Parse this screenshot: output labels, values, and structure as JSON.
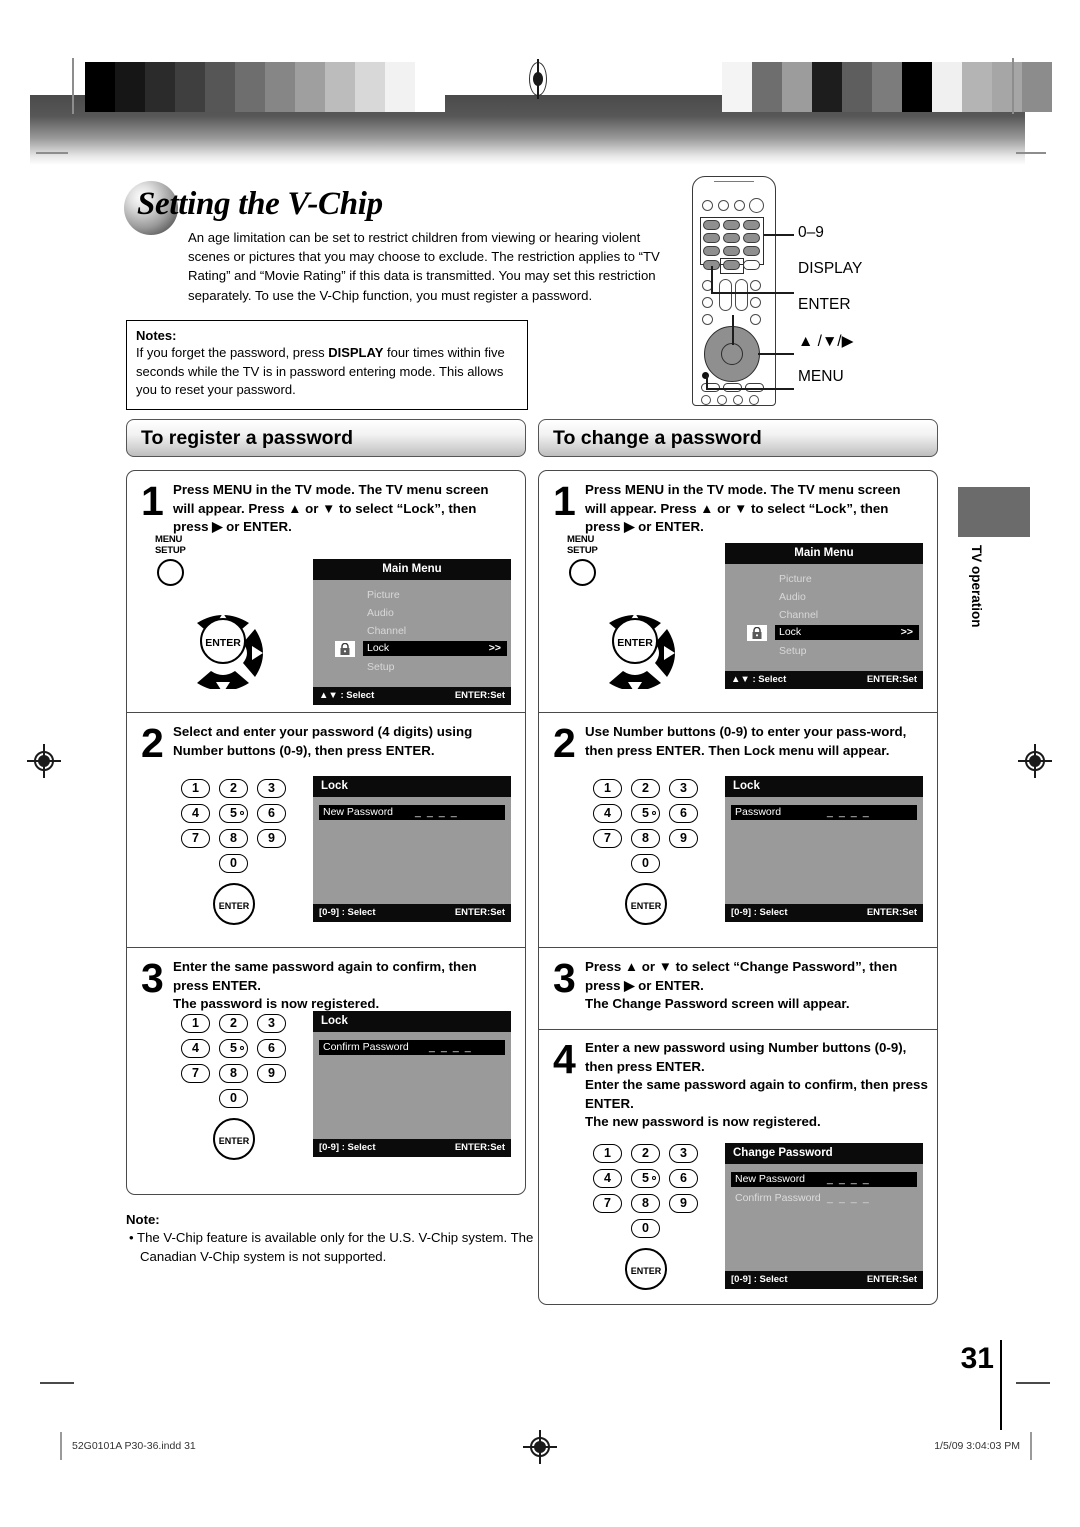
{
  "document": {
    "page_title": "Setting the V-Chip",
    "page_number": "31",
    "side_tab_label": "TV operation",
    "footer_left": "52G0101A P30-36.indd   31",
    "footer_right": "1/5/09   3:04:03 PM"
  },
  "intro": {
    "paragraph": "An age limitation can be set to restrict children from viewing or hearing violent scenes or pictures that you may choose to exclude.  The restriction applies to “TV Rating” and “Movie Rating” if this data is transmitted.  You may set this restriction separately.  To use the V-Chip function, you must register a password."
  },
  "notes_box": {
    "title": "Notes:",
    "text_part1": "If you forget the password, press ",
    "emphasis": "DISPLAY",
    "text_part2": " four times within five seconds while the TV is in password entering mode. This allows you to reset your password."
  },
  "remote": {
    "callouts": [
      {
        "label": "0–9"
      },
      {
        "label": "DISPLAY"
      },
      {
        "label": "ENTER"
      },
      {
        "label": "▲ /▼/▶"
      },
      {
        "label": "MENU"
      }
    ]
  },
  "keypad": {
    "keys": [
      "1",
      "2",
      "3",
      "4",
      "5",
      "6",
      "7",
      "8",
      "9",
      "0"
    ],
    "enter_label": "ENTER",
    "menu_setup_line1": "MENU",
    "menu_setup_line2": "SETUP"
  },
  "osd": {
    "main_menu": {
      "title": "Main Menu",
      "items": [
        "Picture",
        "Audio",
        "Channel",
        "Lock",
        "Setup"
      ],
      "selected_item": "Lock",
      "selected_value": ">>",
      "icon": "lock-icon",
      "foot_left": "▲▼ : Select",
      "foot_right": "ENTER:Set"
    },
    "lock_new": {
      "title": "Lock",
      "field_label": "New Password",
      "field_value": "_ _ _ _",
      "foot_left": "[0-9] : Select",
      "foot_right": "ENTER:Set"
    },
    "lock_confirm": {
      "title": "Lock",
      "field_label": "Confirm Password",
      "field_value": "_ _ _ _",
      "foot_left": "[0-9] : Select",
      "foot_right": "ENTER:Set"
    },
    "lock_password": {
      "title": "Lock",
      "field_label": "Password",
      "field_value": "_ _ _ _",
      "foot_left": "[0-9] : Select",
      "foot_right": "ENTER:Set"
    },
    "change_password": {
      "title": "Change Password",
      "field1_label": "New Password",
      "field1_value": "_ _ _ _",
      "field2_label": "Confirm Password",
      "field2_value": "_ _ _ _",
      "foot_left": "[0-9] : Select",
      "foot_right": "ENTER:Set"
    }
  },
  "register_section": {
    "header": "To register a password",
    "steps": [
      {
        "num": "1",
        "text": "Press MENU in the TV mode. The TV menu screen will appear. Press ▲ or ▼ to select “Lock”, then press ▶ or ENTER."
      },
      {
        "num": "2",
        "text": "Select and enter your password (4 digits) using Number buttons (0-9), then press ENTER."
      },
      {
        "num": "3",
        "text": "Enter the same password again to confirm, then press ENTER.\nThe password is now registered."
      }
    ]
  },
  "change_section": {
    "header": "To change a password",
    "steps": [
      {
        "num": "1",
        "text": "Press MENU in the TV mode. The TV menu screen will appear. Press ▲ or ▼ to select “Lock”, then press ▶ or ENTER."
      },
      {
        "num": "2",
        "text": "Use Number buttons (0-9) to enter your pass-word, then press ENTER. Then Lock menu will appear."
      },
      {
        "num": "3",
        "text": "Press ▲ or ▼ to select “Change Password”, then press ▶ or ENTER.\nThe Change Password screen will appear."
      },
      {
        "num": "4",
        "text": "Enter a new password using Number buttons (0-9), then press ENTER.\nEnter the same password again to confirm, then press ENTER.\nThe new password is now registered."
      }
    ]
  },
  "bottom_note": {
    "title": "Note:",
    "bullet": "•  The V-Chip feature is available only for the U.S. V-Chip system. The Canadian V-Chip system is not supported."
  },
  "colors": {
    "osd_bg": "#9a9a9a",
    "osd_bar": "#0b0b0b",
    "side_tab": "#6b6b6b"
  }
}
